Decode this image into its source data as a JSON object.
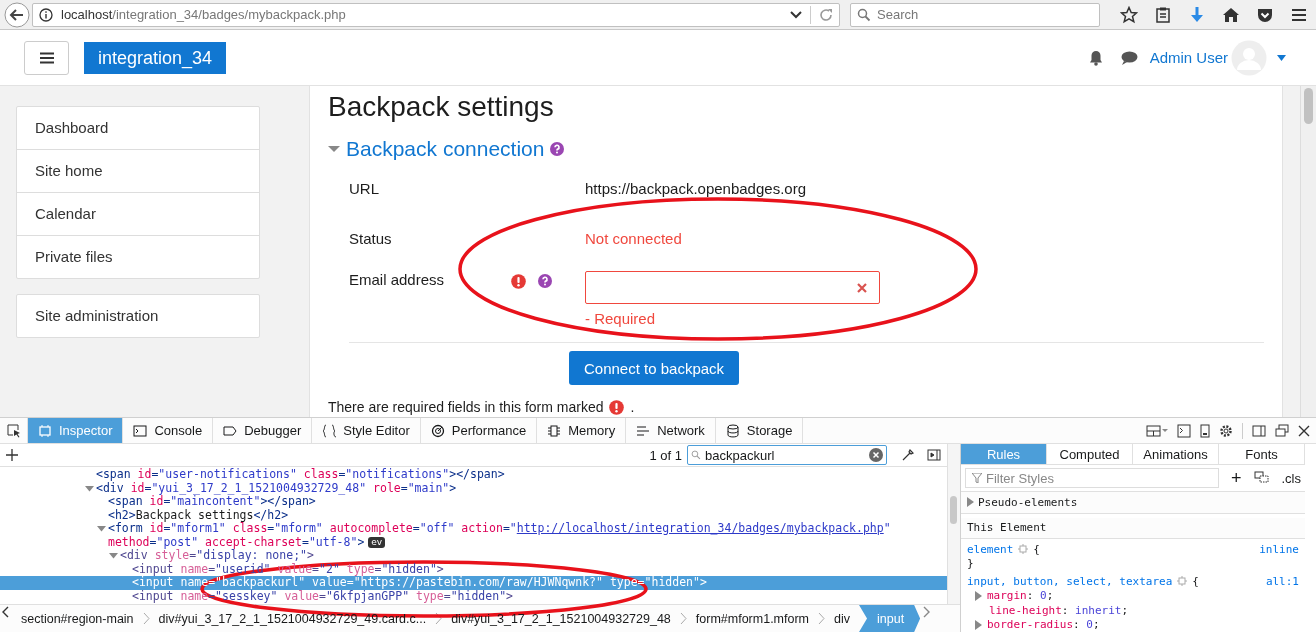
{
  "browser": {
    "url": {
      "host": "localhost",
      "path": "/integration_34/badges/mybackpack.php"
    },
    "search": {
      "placeholder": "Search"
    }
  },
  "navbar": {
    "brand": "integration_34",
    "user": "Admin User"
  },
  "sidebar": {
    "groups": [
      [
        "Dashboard",
        "Site home",
        "Calendar",
        "Private files"
      ],
      [
        "Site administration"
      ]
    ]
  },
  "main": {
    "title": "Backpack settings",
    "section": {
      "title": "Backpack connection",
      "expanded": true
    },
    "rows": [
      {
        "kind": "static",
        "label": "URL",
        "value": "https://backpack.openbadges.org"
      },
      {
        "kind": "status",
        "label": "Status",
        "value": "Not connected"
      },
      {
        "kind": "field",
        "label": "Email address",
        "required": true,
        "error": "- Required"
      }
    ],
    "button": "Connect to backpack",
    "note": "There are required fields in this form marked",
    "note_end": "."
  },
  "devtools": {
    "tabs": [
      {
        "label": "Inspector",
        "selected": true
      },
      {
        "label": "Console",
        "selected": false
      },
      {
        "label": "Debugger",
        "selected": false
      },
      {
        "label": "Style Editor",
        "selected": false
      },
      {
        "label": "Performance",
        "selected": false
      },
      {
        "label": "Memory",
        "selected": false
      },
      {
        "label": "Network",
        "selected": false
      },
      {
        "label": "Storage",
        "selected": false
      }
    ],
    "search": {
      "count": "1 of 1",
      "value": "backpackurl"
    },
    "lines": [
      {
        "text": "<span id=\"user-notifications\" class=\"notifications\"></span>",
        "selected": false,
        "dimmed": false
      },
      {
        "text": "<div id=\"yui_3_17_2_1_1521004932729_48\" role=\"main\">",
        "expanded": true,
        "selected": false,
        "dimmed": false,
        "children": [
          {
            "text": "<span id=\"maincontent\"></span>",
            "selected": false,
            "dimmed": false
          },
          {
            "text": "<h2>Backpack settings</h2>",
            "selected": false,
            "dimmed": false
          },
          {
            "text": "<form id=\"mform1\" class=\"mform\" autocomplete=\"off\" action=\"http://localhost/integration_34/badges/mybackpack.php\"",
            "continuation": "method=\"post\" accept-charset=\"utf-8\">",
            "badge": "ev",
            "expanded": true,
            "selected": false,
            "dimmed": false,
            "children": [
              {
                "text": "<div style=\"display: none;\">",
                "expanded": true,
                "selected": false,
                "dimmed": true,
                "children": [
                  {
                    "text": "<input name=\"userid\" value=\"2\" type=\"hidden\">",
                    "selected": false,
                    "dimmed": true
                  },
                  {
                    "text": "<input name=\"backpackurl\" value=\"https://pastebin.com/raw/HJWNqwnk?\" type=\"hidden\">",
                    "selected": true,
                    "dimmed": true
                  },
                  {
                    "text": "<input name=\"sesskey\" value=\"6kfpjanGPP\" type=\"hidden\">",
                    "selected": false,
                    "dimmed": true
                  }
                ]
              }
            ]
          }
        ]
      }
    ],
    "breadcrumbs": [
      {
        "label": "section#region-main",
        "selected": false
      },
      {
        "label": "div#yui_3_17_2_1_1521004932729_49.card.c...",
        "selected": false
      },
      {
        "label": "div#yui_3_17_2_1_1521004932729_48",
        "selected": false
      },
      {
        "label": "form#mform1.mform",
        "selected": false
      },
      {
        "label": "div",
        "selected": false
      },
      {
        "label": "input",
        "selected": true
      }
    ],
    "side_tabs": [
      {
        "label": "Rules",
        "selected": true
      },
      {
        "label": "Computed",
        "selected": false
      },
      {
        "label": "Animations",
        "selected": false
      },
      {
        "label": "Fonts",
        "selected": false
      }
    ],
    "filter": {
      "placeholder": "Filter Styles"
    },
    "add": "+",
    "cls": ".cls",
    "pseudo": "Pseudo-elements",
    "element_header": "This Element",
    "rules": [
      {
        "selector": "element",
        "open": "{",
        "source": "inline",
        "close": "}"
      },
      {
        "selector": "input, button, select, textarea",
        "open": "{",
        "source": "all:1",
        "declarations": [
          {
            "text": "margin: 0;",
            "expandable": true
          },
          {
            "text": "line-height: inherit;",
            "expandable": false
          },
          {
            "text": "border-radius: 0;",
            "expandable": true
          }
        ]
      }
    ]
  },
  "annotations": [
    {
      "kind": "ellipse"
    },
    {
      "kind": "ellipse"
    }
  ]
}
